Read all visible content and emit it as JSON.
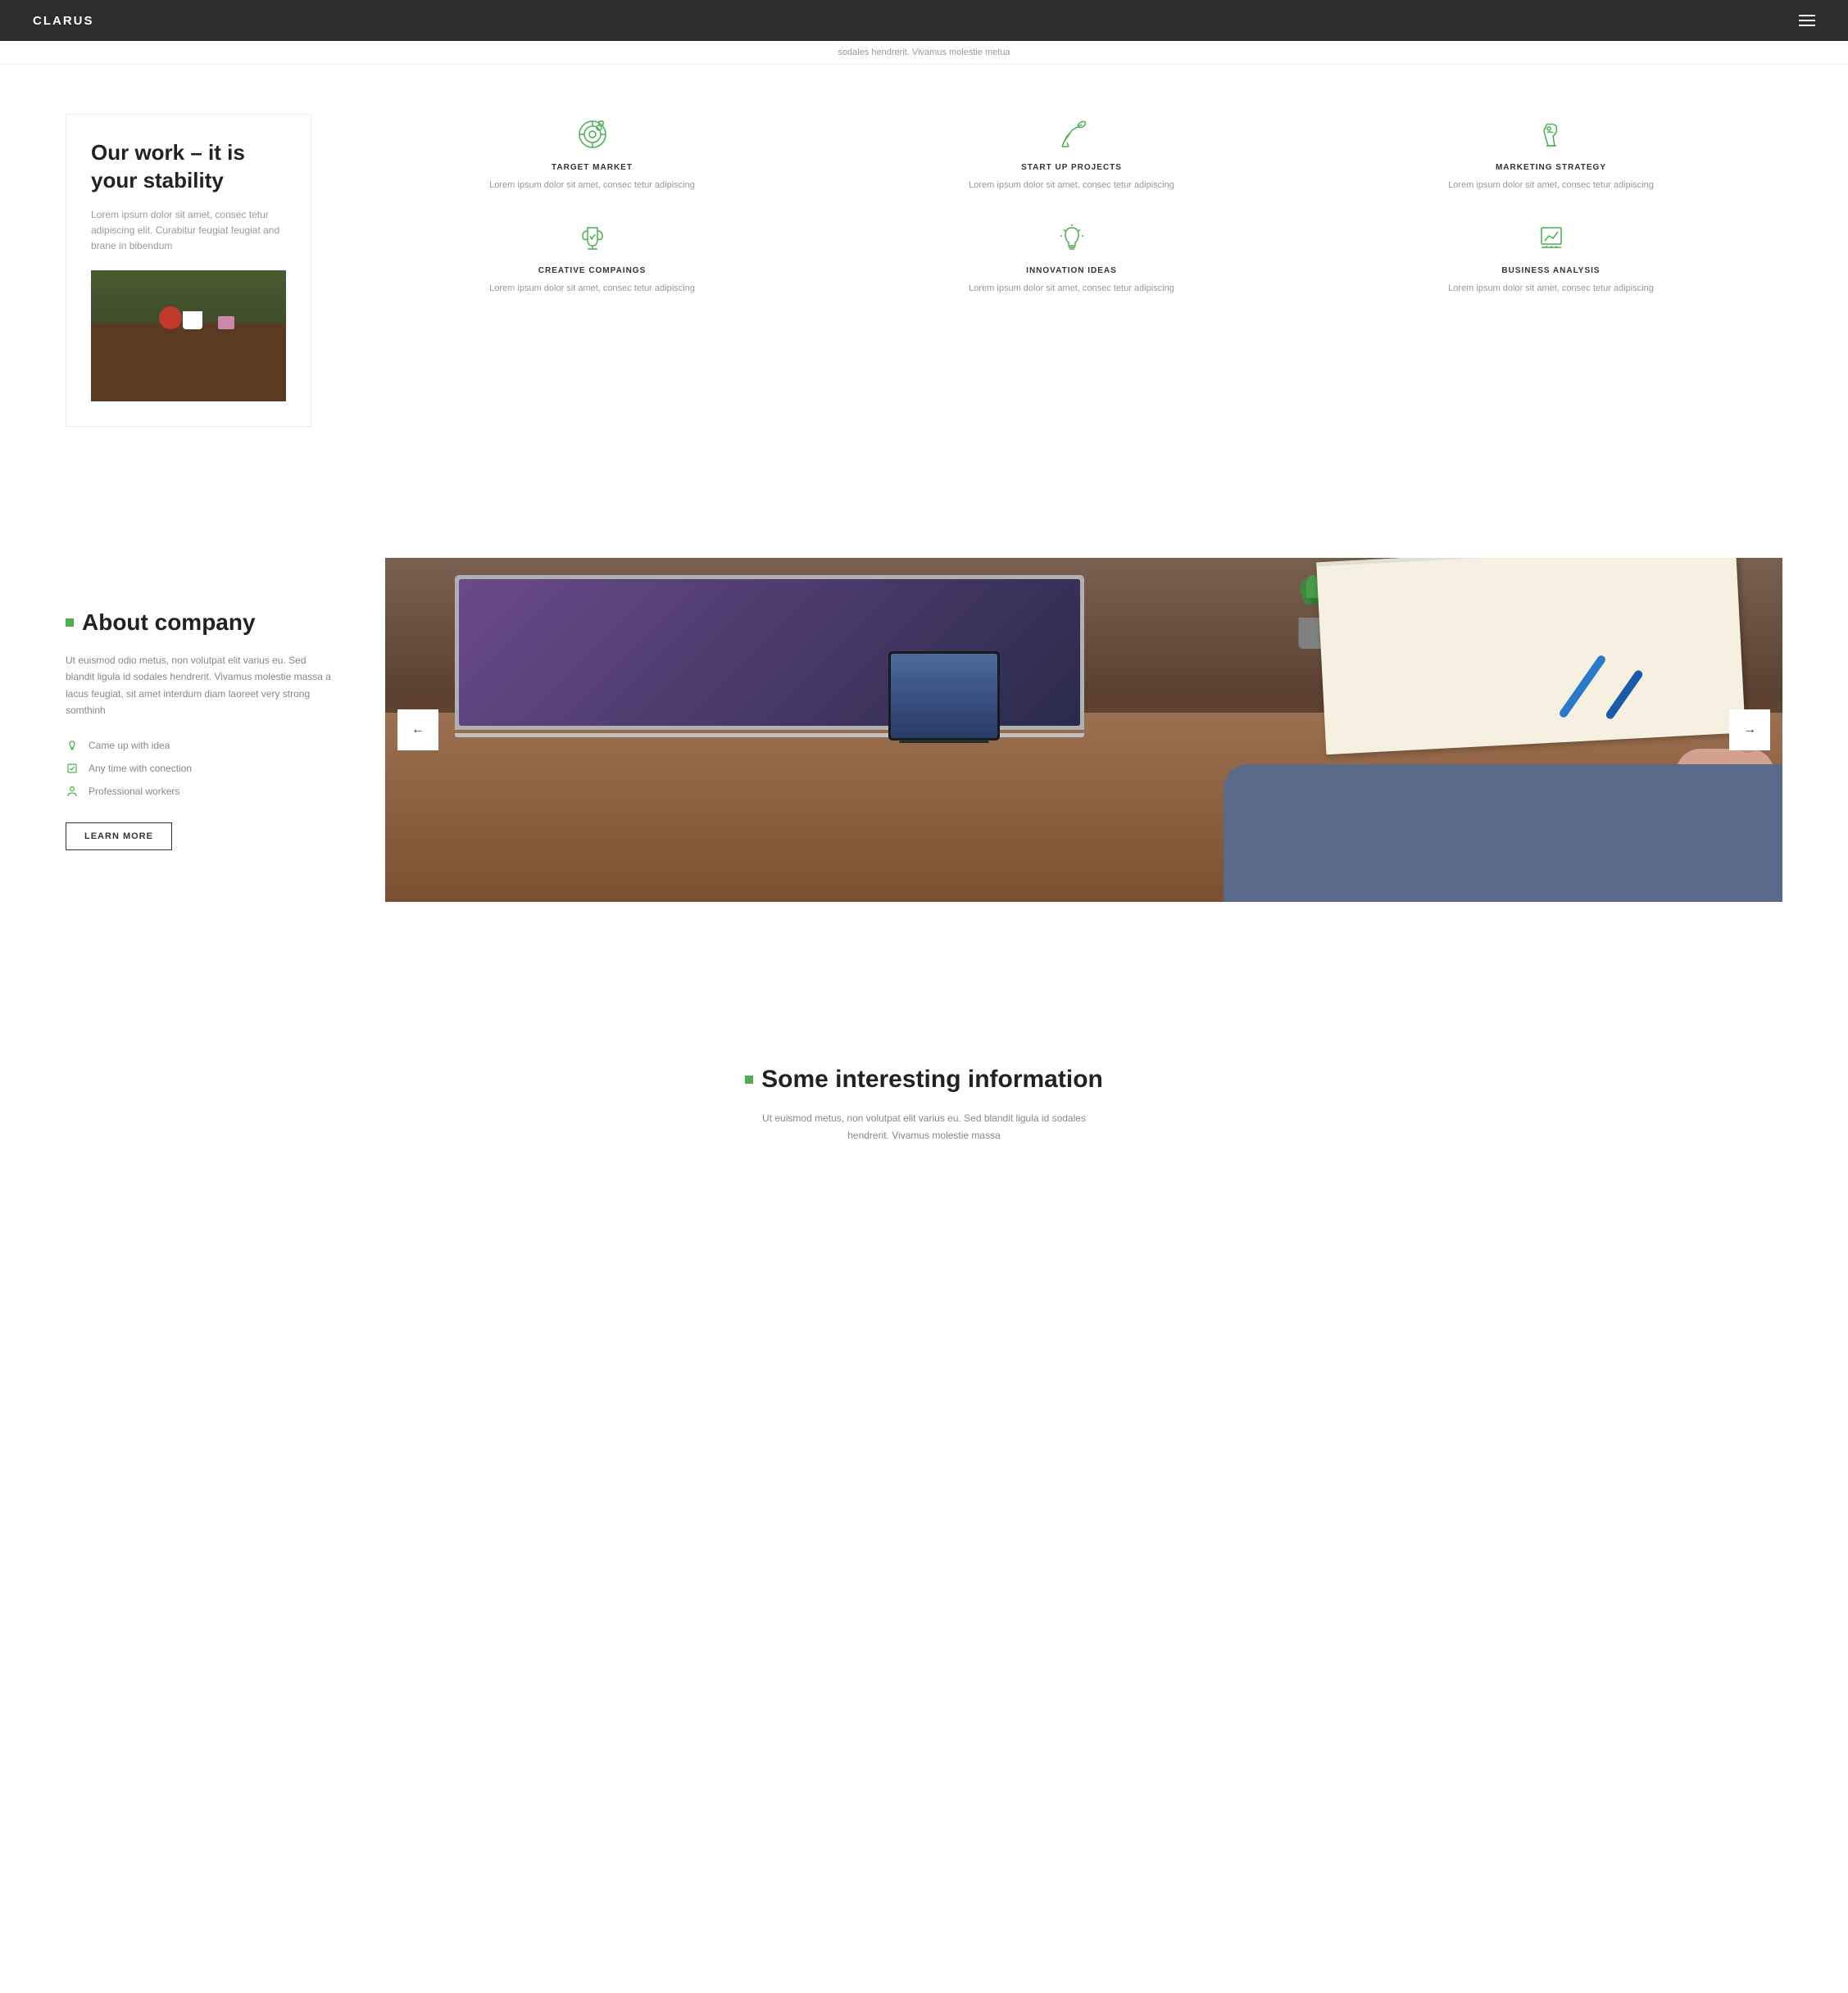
{
  "navbar": {
    "brand": "CLARUS",
    "menu_icon_label": "menu"
  },
  "marquee": {
    "text": "sodales hendrerit. Vivamus molestie metua"
  },
  "our_work": {
    "heading": "Our work – it is your stability",
    "description": "Lorem ipsum dolor sit amet, consec tetur adipiscing elit. Curabitur feugiat feugiat and brane in bibendum",
    "features": [
      {
        "id": "target-market",
        "title": "TARGET MARKET",
        "icon": "target-icon",
        "description": "Lorem ipsum dolor sit amet, consec tetur adipiscing"
      },
      {
        "id": "start-up",
        "title": "START UP PROJECTS",
        "icon": "telescope-icon",
        "description": "Lorem ipsum dolor sit amet, consec tetur adipiscing"
      },
      {
        "id": "marketing",
        "title": "MARKETING STRATEGY",
        "icon": "chess-knight-icon",
        "description": "Lorem ipsum dolor sit amet, consec tetur adipiscing"
      },
      {
        "id": "creative",
        "title": "CREATIVE COMPAINGS",
        "icon": "trophy-icon",
        "description": "Lorem ipsum dolor sit amet, consec tetur adipiscing"
      },
      {
        "id": "innovation",
        "title": "INNOVATION IDEAS",
        "icon": "lightbulb-icon",
        "description": "Lorem ipsum dolor sit amet, consec tetur adipiscing"
      },
      {
        "id": "business",
        "title": "BUSINESS ANALYSIS",
        "icon": "chart-icon",
        "description": "Lorem ipsum dolor sit amet, consec tetur adipiscing"
      }
    ]
  },
  "about": {
    "heading": "About company",
    "description": "Ut euismod odio metus, non volutpat elit varius eu. Sed blandit ligula id sodales hendrerit. Vivamus molestie massa a lacus feugiat, sit amet interdum diam laoreet very strong somthinh",
    "list_items": [
      {
        "icon": "lightbulb-list-icon",
        "text": "Came up with idea"
      },
      {
        "icon": "checkbox-list-icon",
        "text": "Any time with conection"
      },
      {
        "icon": "person-list-icon",
        "text": "Professional workers"
      }
    ],
    "learn_more_label": "LEARN MORE",
    "carousel_left": "←",
    "carousel_right": "→"
  },
  "interesting_info": {
    "heading": "Some interesting information",
    "description": "Ut euismod metus, non volutpat elit varius eu. Sed blandit ligula id sodales hendrerit. Vivamus molestie massa"
  },
  "colors": {
    "accent": "#4caf50",
    "dark_bg": "#2d2d2d",
    "text_muted": "#999999",
    "border": "#e0e0e0"
  }
}
